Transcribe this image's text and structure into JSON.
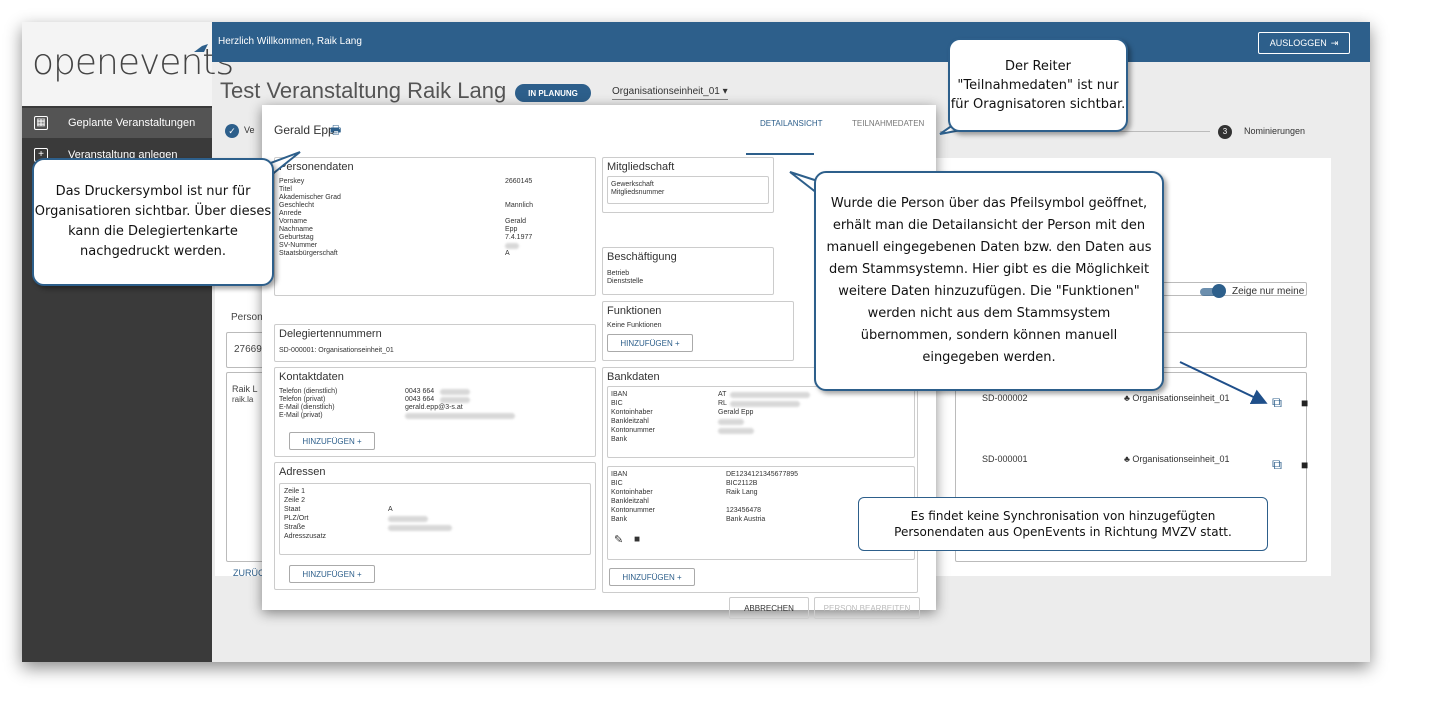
{
  "app": {
    "logo": "openevents",
    "welcome": "Herzlich Willkommen, Raik Lang",
    "logout_label": "AUSLOGGEN"
  },
  "sidebar": {
    "items": [
      {
        "label": "Geplante Veranstaltungen",
        "icon": "calendar-icon",
        "active": true
      },
      {
        "label": "Veranstaltung anlegen",
        "icon": "plus-icon",
        "active": false
      }
    ]
  },
  "event": {
    "title": "Test Veranstaltung Raik Lang",
    "status": "IN PLANUNG",
    "org_unit": "Organisationseinheit_01"
  },
  "stepper": {
    "first_label": "Ve",
    "last_number": "3",
    "last_label": "Nominierungen"
  },
  "background": {
    "person_label": "Person",
    "input_value": "27669",
    "card_line1": "Raik L",
    "card_line2": "raik.la",
    "back_label": "ZURÜC",
    "toggle_label": "Zeige nur meine",
    "rows": [
      {
        "code": "SD-000002",
        "org": "Organisationseinheit_01"
      },
      {
        "code": "SD-000001",
        "org": "Organisationseinheit_01"
      }
    ]
  },
  "modal": {
    "person_name": "Gerald Epp",
    "tabs": {
      "active": "DETAILANSICHT",
      "inactive": "TEILNAHMEDATEN"
    },
    "personendaten": {
      "title": "Personendaten",
      "fields": [
        {
          "label": "Perskey",
          "value": "2660145"
        },
        {
          "label": "Titel",
          "value": ""
        },
        {
          "label": "Akademischer Grad",
          "value": ""
        },
        {
          "label": "Geschlecht",
          "value": "Mannlich"
        },
        {
          "label": "Anrede",
          "value": ""
        },
        {
          "label": "Vorname",
          "value": "Gerald"
        },
        {
          "label": "Nachname",
          "value": "Epp"
        },
        {
          "label": "Geburtstag",
          "value": "7.4.1977"
        },
        {
          "label": "SV-Nummer",
          "value": ""
        },
        {
          "label": "Staatsbürgerschaft",
          "value": "A"
        }
      ]
    },
    "delegiertennummern": {
      "title": "Delegiertennummern",
      "entry": "SD-000001: Organisationseinheit_01"
    },
    "kontaktdaten": {
      "title": "Kontaktdaten",
      "fields": [
        {
          "label": "Telefon (dienstlich)",
          "value": "0043 664"
        },
        {
          "label": "Telefon (privat)",
          "value": "0043 664"
        },
        {
          "label": "E-Mail (dienstlich)",
          "value": "gerald.epp@3-s.at"
        },
        {
          "label": "E-Mail (privat)",
          "value": ""
        }
      ],
      "add_label": "HINZUFÜGEN"
    },
    "adressen": {
      "title": "Adressen",
      "fields": [
        {
          "label": "Zeile 1",
          "value": ""
        },
        {
          "label": "Zeile 2",
          "value": ""
        },
        {
          "label": "Staat",
          "value": "A"
        },
        {
          "label": "PLZ/Ort",
          "value": ""
        },
        {
          "label": "Straße",
          "value": ""
        },
        {
          "label": "Adresszusatz",
          "value": ""
        }
      ],
      "add_label": "HINZUFÜGEN"
    },
    "mitgliedschaft": {
      "title": "Mitgliedschaft",
      "fields": [
        {
          "label": "Gewerkschaft"
        },
        {
          "label": "Mitgliedsnummer"
        }
      ]
    },
    "beschaeftigung": {
      "title": "Beschäftigung",
      "fields": [
        {
          "label": "Betrieb"
        },
        {
          "label": "Dienststelle"
        }
      ]
    },
    "funktionen": {
      "title": "Funktionen",
      "empty_text": "Keine Funktionen",
      "add_label": "HINZUFÜGEN"
    },
    "bankdaten": {
      "title": "Bankdaten",
      "account1": [
        {
          "label": "IBAN",
          "value": "AT"
        },
        {
          "label": "BIC",
          "value": "RL"
        },
        {
          "label": "Kontoinhaber",
          "value": "Gerald Epp"
        },
        {
          "label": "Bankleitzahl",
          "value": ""
        },
        {
          "label": "Kontonummer",
          "value": ""
        },
        {
          "label": "Bank",
          "value": ""
        }
      ],
      "account2": [
        {
          "label": "IBAN",
          "value": "DE1234121345677895"
        },
        {
          "label": "BIC",
          "value": "BIC2112B"
        },
        {
          "label": "Kontoinhaber",
          "value": "Raik Lang"
        },
        {
          "label": "Bankleitzahl",
          "value": ""
        },
        {
          "label": "Kontonummer",
          "value": "123456478"
        },
        {
          "label": "Bank",
          "value": "Bank Austria"
        }
      ],
      "add_label": "HINZUFÜGEN"
    },
    "footer": {
      "cancel": "ABBRECHEN",
      "edit": "PERSON BEARBEITEN"
    }
  },
  "callouts": {
    "reiter": "Der Reiter \"Teilnahmedaten\" ist nur für Oragnisatoren sichtbar.",
    "drucker": "Das Druckersymbol ist nur für Organisatioren sichtbar. Über dieses kann die Delegiertenkarte nachgedruckt werden.",
    "pfeil": "Wurde die Person über das Pfeilsymbol geöffnet, erhält man die Detailansicht der Person mit den manuell eingegebenen Daten bzw. den Daten aus dem Stammsystemn. Hier gibt es die Möglichkeit weitere Daten hinzuzufügen.  Die \"Funktionen\" werden nicht aus dem Stammsystem übernommen, sondern können manuell eingegeben werden.",
    "sync": "Es findet keine Synchronisation von hinzugefügten Personendaten aus OpenEvents in Richtung MVZV statt."
  },
  "colors": {
    "primary": "#2d5f8b",
    "sidebar": "#3a3a3a"
  }
}
